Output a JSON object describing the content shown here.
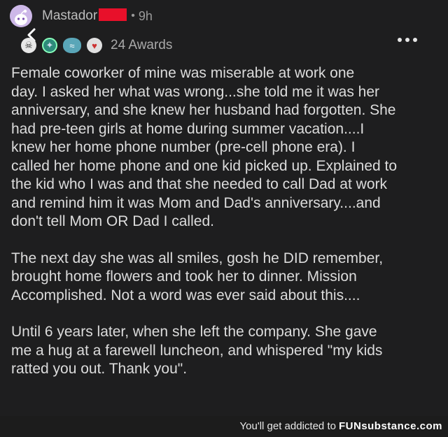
{
  "post": {
    "username": "Mastador",
    "separator": "•",
    "time": "9h",
    "awards_count": "24 Awards",
    "paragraphs": [
      "Female coworker of mine was miserable at work one\nday. I asked her what was wrong...she told me it was her\nanniversary, and she knew her husband had forgotten. She\nhad pre-teen girls at home during summer vacation....I\nknew her home phone number (pre-cell phone era). I\ncalled her home phone and one kid picked up. Explained to\nthe kid who I was and that she needed to call Dad at work\nand remind him it was Mom and Dad's anniversary....and\ndon't tell Mom OR Dad I called.",
      "The next day she was all smiles, gosh he DID remember,\nbrought home flowers and took her to dinner. Mission\nAccomplished. Not a word was ever said about this....",
      "Until 6 years later, when she left the company. She gave\nme a hug at a farewell luncheon, and whispered \"my kids\nratted you out. Thank you\"."
    ]
  },
  "icons": {
    "avatar": "snoo-avatar-icon",
    "back": "chevron-left-icon",
    "more": "more-options-icon",
    "awards": [
      "skull-award-icon",
      "medal-award-icon",
      "wave-award-icon",
      "helper-award-icon"
    ]
  },
  "watermark": {
    "text": "You'll get addicted to",
    "brand": "FUNsubstance.com"
  },
  "colors": {
    "background": "#1e1e1f",
    "text": "#dcdcdc",
    "redaction": "#e8102a"
  }
}
